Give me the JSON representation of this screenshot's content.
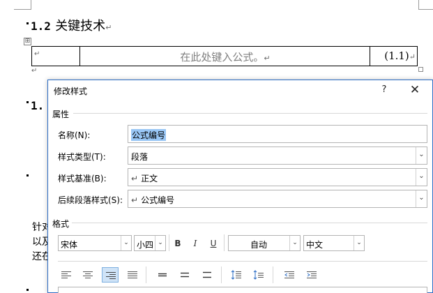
{
  "document": {
    "heading1": {
      "number": "1.2",
      "title": "关键技术"
    },
    "heading2_partial": "1.",
    "equation_placeholder": "在此处键入公式。",
    "equation_number": "(1.1)",
    "return_mark": "↵",
    "body_lines": [
      "针对",
      "以及",
      "还在"
    ],
    "table_handle_glyph": "⊞"
  },
  "dialog": {
    "title": "修改样式",
    "help_label": "?",
    "close_label": "✕",
    "sections": {
      "properties": "属性",
      "format": "格式"
    },
    "properties": {
      "name_label": "名称(N):",
      "name_value": "公式编号",
      "style_type_label": "样式类型(T):",
      "style_type_value": "段落",
      "style_based_label": "样式基准(B):",
      "style_based_value": "正文",
      "next_style_label": "后续段落样式(S):",
      "next_style_value": "公式编号",
      "para_glyph": "↵"
    },
    "format": {
      "font_value": "宋体",
      "size_value": "小四",
      "bold_label": "B",
      "italic_label": "I",
      "underline_label": "U",
      "color_value": "自动",
      "script_value": "中文"
    },
    "dropdown_glyph": "⌄",
    "alignment": {
      "active": "right",
      "buttons": [
        "align-left",
        "align-center",
        "align-right",
        "align-justify",
        "line-spacing-single",
        "line-spacing-1-5",
        "line-spacing-double",
        "spacing-before-increase",
        "spacing-before-decrease",
        "indent-decrease",
        "indent-increase"
      ]
    },
    "colors": {
      "border": "#2b6cc4",
      "selection": "#99c6f5",
      "active_button": "#cfe3f7"
    }
  }
}
